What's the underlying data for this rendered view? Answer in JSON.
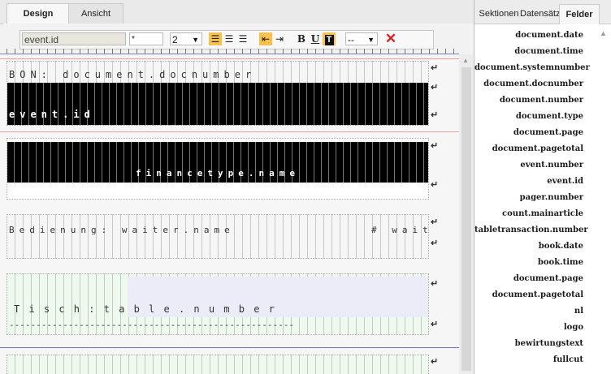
{
  "tabs": {
    "design": "Design",
    "ansicht": "Ansicht"
  },
  "toolbar": {
    "field_name": "event.id",
    "field_star": "*",
    "font_size": "2",
    "combo": "--"
  },
  "sections": {
    "bon_label": "BON:  document.docnumber",
    "event_id": "event.id",
    "financetype": "financetype.name",
    "bedienung": "Bedienung:  waiter.name",
    "wait": "#  wait",
    "tisch": "T i s c h :   t a b l e . n u m b e r",
    "dashes": "-----------------------------------------------------"
  },
  "panel": {
    "tabs": {
      "sektionen": "Sektionen",
      "datensaetze": "Datensätz",
      "felder": "Felder"
    },
    "fields": [
      "document.date",
      "document.time",
      "document.systemnumber",
      "document.docnumber",
      "document.number",
      "document.type",
      "document.page",
      "document.pagetotal",
      "event.number",
      "event.id",
      "pager.number",
      "count.mainarticle",
      "tabletransaction.number",
      "book.date",
      "book.time",
      "document.page",
      "document.pagetotal",
      "nl",
      "logo",
      "bewirtungstext",
      "fullcut"
    ]
  }
}
